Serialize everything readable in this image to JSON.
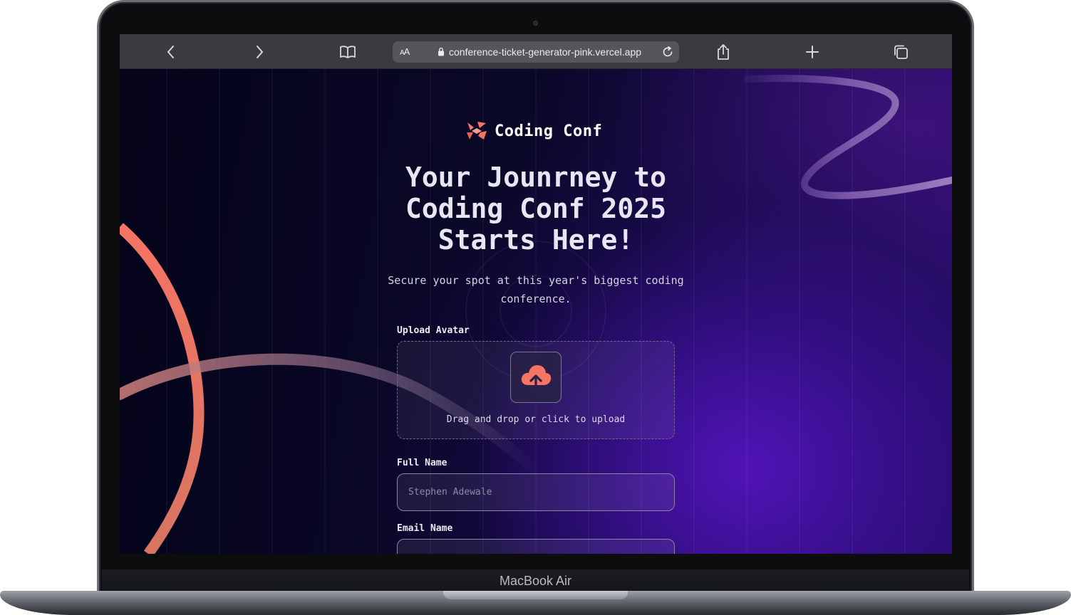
{
  "device": {
    "brand_label": "MacBook Air"
  },
  "browser": {
    "reader_label": "AA",
    "url": "conference-ticket-generator-pink.vercel.app",
    "icons": [
      "chevron-left-icon",
      "chevron-right-icon",
      "book-icon",
      "lock-icon",
      "reload-icon",
      "share-icon",
      "plus-icon",
      "tabs-icon"
    ]
  },
  "page": {
    "logo_text": "Coding Conf",
    "headline_lines": [
      "Your Jounrney to",
      "Coding Conf 2025",
      "Starts Here!"
    ],
    "subtitle": "Secure your spot at this year's biggest coding conference.",
    "form": {
      "avatar_label": "Upload Avatar",
      "avatar_hint": "Drag and drop or click to upload",
      "full_name_label": "Full Name",
      "full_name_placeholder": "Stephen Adewale",
      "email_label": "Email Name",
      "email_placeholder": ""
    },
    "colors": {
      "accent": "#f57463",
      "background": "#07051a",
      "purple_glow": "#4b14b4"
    }
  }
}
